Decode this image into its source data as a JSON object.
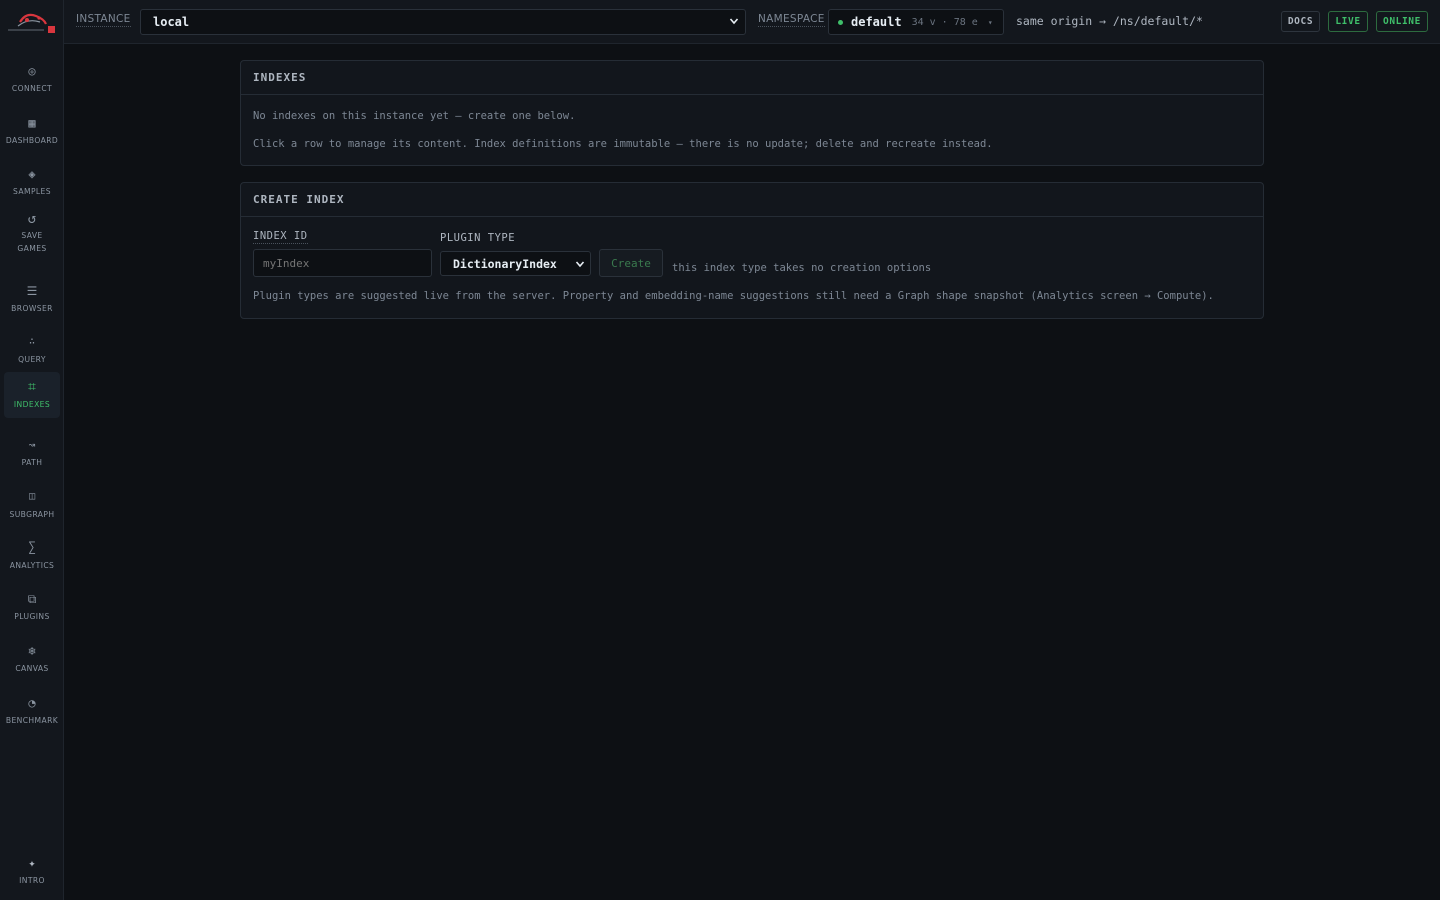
{
  "sidebar": {
    "items": [
      {
        "label": "CONNECT",
        "icon": "target-icon"
      },
      {
        "label": "DASHBOARD",
        "icon": "grid-icon"
      },
      {
        "label": "SAMPLES",
        "icon": "diamond-icon"
      },
      {
        "label": "SAVE",
        "label2": "GAMES",
        "icon": "refresh-icon"
      },
      {
        "label": "BROWSER",
        "icon": "list-icon"
      },
      {
        "label": "QUERY",
        "icon": "dots-icon"
      },
      {
        "label": "INDEXES",
        "icon": "hash-icon",
        "active": true
      },
      {
        "label": "PATH",
        "icon": "wave-icon"
      },
      {
        "label": "SUBGRAPH",
        "icon": "square-icon"
      },
      {
        "label": "ANALYTICS",
        "icon": "sigma-icon"
      },
      {
        "label": "PLUGINS",
        "icon": "layers-icon"
      },
      {
        "label": "CANVAS",
        "icon": "snowflake-icon"
      },
      {
        "label": "BENCHMARK",
        "icon": "gauge-icon"
      },
      {
        "label": "INTRO",
        "icon": "sparkle-icon"
      }
    ]
  },
  "topbar": {
    "instance_label": "INSTANCE",
    "instance_value": "local",
    "namespace_label": "NAMESPACE",
    "namespace_name": "default",
    "namespace_stats": "34 v · 78 e",
    "namespace_caret": "▾",
    "origin": "same origin → /ns/default/*",
    "docs": "DOCS",
    "live": "LIVE",
    "online": "ONLINE"
  },
  "indexes_panel": {
    "title": "INDEXES",
    "empty_text": "No indexes on this instance yet — create one below.",
    "help_text": "Click a row to manage its content. Index definitions are immutable — there is no update; delete and recreate instead."
  },
  "create_panel": {
    "title": "CREATE INDEX",
    "index_id_label": "INDEX ID",
    "index_id_placeholder": "myIndex",
    "plugin_type_label": "PLUGIN TYPE",
    "plugin_type_value": "DictionaryIndex",
    "create_label": "Create",
    "options_note": "this index type takes no creation options",
    "footer_note": "Plugin types are suggested live from the server. Property and embedding-name suggestions still need a Graph shape snapshot (Analytics screen → Compute)."
  },
  "colors": {
    "background": "#0d1014",
    "panel": "#12161c",
    "accent_green": "#3fbf6a",
    "logo_red": "#d9363e"
  }
}
